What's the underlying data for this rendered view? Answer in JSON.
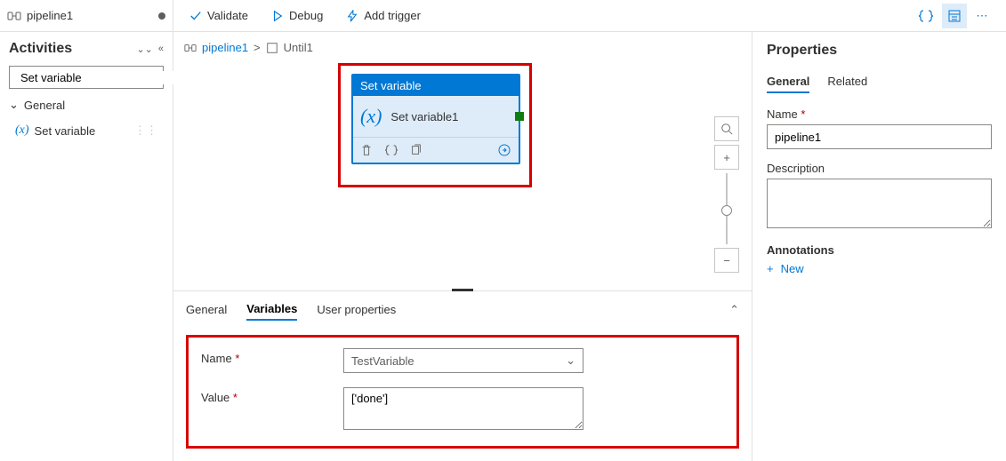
{
  "tab": {
    "title": "pipeline1"
  },
  "sidebar": {
    "title": "Activities",
    "search_placeholder": "Set variable",
    "group_label": "General",
    "items": [
      {
        "label": "Set variable"
      }
    ]
  },
  "toolbar": {
    "validate": "Validate",
    "debug": "Debug",
    "add_trigger": "Add trigger"
  },
  "breadcrumb": {
    "root": "pipeline1",
    "sep": ">",
    "current": "Until1"
  },
  "node": {
    "type_label": "Set variable",
    "name": "Set variable1"
  },
  "bottom_tabs": {
    "general": "General",
    "variables": "Variables",
    "user_properties": "User properties"
  },
  "form": {
    "name_label": "Name",
    "name_value": "TestVariable",
    "value_label": "Value",
    "value_value": "['done']"
  },
  "properties": {
    "title": "Properties",
    "tabs": {
      "general": "General",
      "related": "Related"
    },
    "name_label": "Name",
    "name_value": "pipeline1",
    "description_label": "Description",
    "description_value": "",
    "annotations_label": "Annotations",
    "new_label": "New"
  }
}
